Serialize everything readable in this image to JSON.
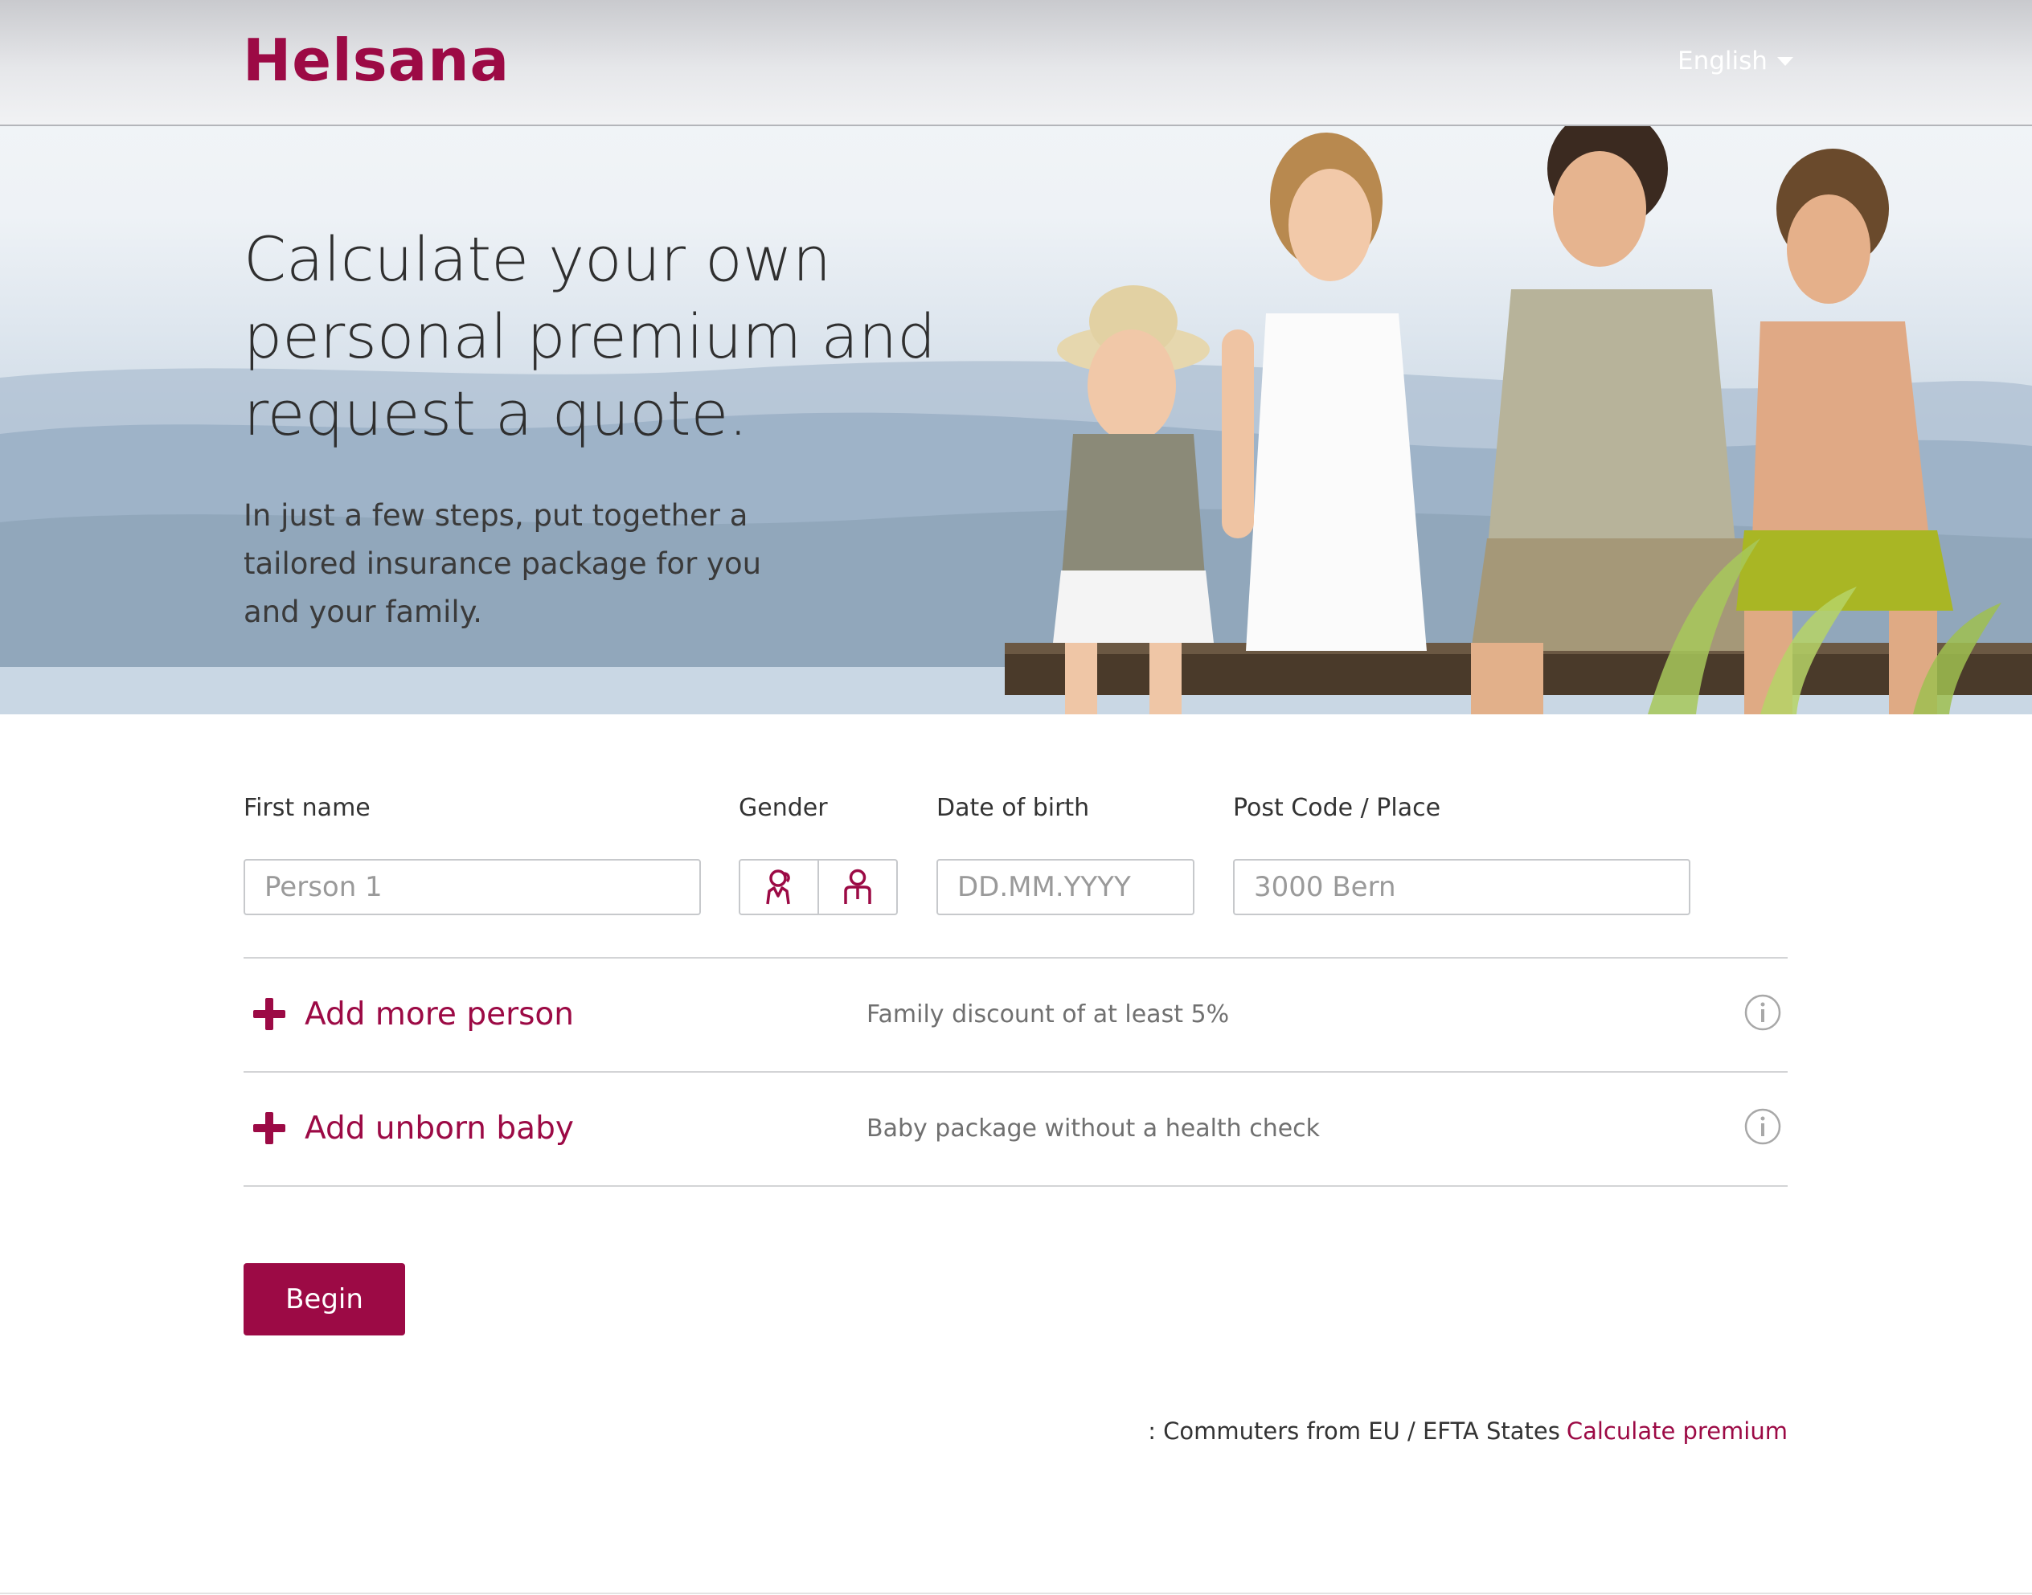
{
  "brand": {
    "name": "Helsana",
    "color": "#9c0a45"
  },
  "header": {
    "language": "English"
  },
  "hero": {
    "title": "Calculate your own personal premium and request a quote.",
    "text": "In just a few steps, put together a tailored insurance package for you and your family."
  },
  "form": {
    "first_name": {
      "label": "First name",
      "placeholder": "Person 1"
    },
    "gender": {
      "label": "Gender",
      "options": [
        "female-icon",
        "male-icon"
      ]
    },
    "date_of_birth": {
      "label": "Date of birth",
      "placeholder": "DD.MM.YYYY"
    },
    "post_code": {
      "label": "Post Code / Place",
      "placeholder": "3000 Bern"
    }
  },
  "add_person": {
    "label": "Add more person",
    "description": "Family discount of at least 5%"
  },
  "add_baby": {
    "label": "Add unborn baby",
    "description": "Baby package without a health check"
  },
  "begin_label": "Begin",
  "footer": {
    "note": ": Commuters from EU / EFTA States",
    "link": "Calculate premium"
  }
}
